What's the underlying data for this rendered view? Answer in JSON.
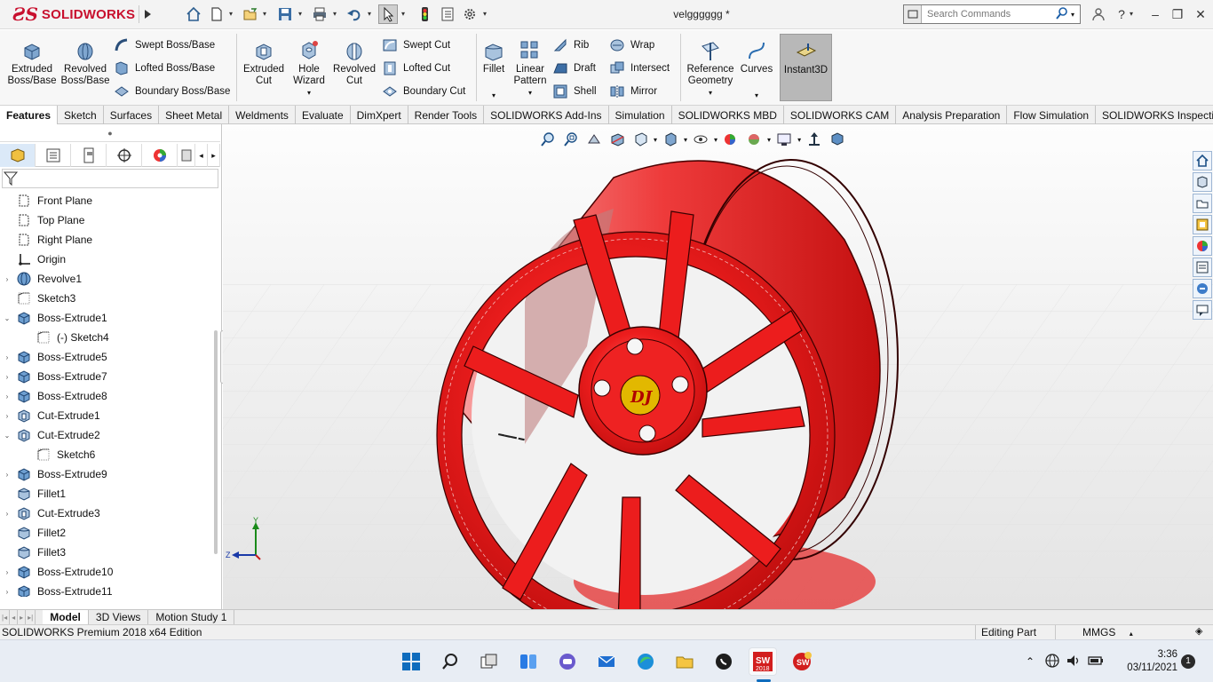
{
  "app": {
    "name": "SOLIDWORKS",
    "document_title": "velgggggg *"
  },
  "search": {
    "placeholder": "Search Commands"
  },
  "ribbon": {
    "extruded_boss": "Extruded\nBoss/Base",
    "revolved_boss": "Revolved\nBoss/Base",
    "swept_boss": "Swept Boss/Base",
    "lofted_boss": "Lofted Boss/Base",
    "boundary_boss": "Boundary Boss/Base",
    "extruded_cut": "Extruded\nCut",
    "hole_wizard": "Hole\nWizard",
    "revolved_cut": "Revolved\nCut",
    "swept_cut": "Swept Cut",
    "lofted_cut": "Lofted Cut",
    "boundary_cut": "Boundary Cut",
    "fillet": "Fillet",
    "linear_pattern": "Linear\nPattern",
    "rib": "Rib",
    "draft": "Draft",
    "shell": "Shell",
    "wrap": "Wrap",
    "intersect": "Intersect",
    "mirror": "Mirror",
    "reference_geometry": "Reference\nGeometry",
    "curves": "Curves",
    "instant3d": "Instant3D"
  },
  "command_tabs": [
    "Features",
    "Sketch",
    "Surfaces",
    "Sheet Metal",
    "Weldments",
    "Evaluate",
    "DimXpert",
    "Render Tools",
    "SOLIDWORKS Add-Ins",
    "Simulation",
    "SOLIDWORKS MBD",
    "SOLIDWORKS CAM",
    "Analysis Preparation",
    "Flow Simulation",
    "SOLIDWORKS Inspection"
  ],
  "tree": {
    "items": [
      {
        "label": "Front Plane",
        "icon": "plane-icon",
        "expand": ""
      },
      {
        "label": "Top Plane",
        "icon": "plane-icon",
        "expand": ""
      },
      {
        "label": "Right Plane",
        "icon": "plane-icon",
        "expand": ""
      },
      {
        "label": "Origin",
        "icon": "origin-icon",
        "expand": ""
      },
      {
        "label": "Revolve1",
        "icon": "revolve-feature-icon",
        "expand": "›"
      },
      {
        "label": "Sketch3",
        "icon": "sketch-icon",
        "expand": ""
      },
      {
        "label": "Boss-Extrude1",
        "icon": "extrude-feature-icon",
        "expand": "⌄"
      },
      {
        "label": "(-) Sketch4",
        "icon": "sketch-icon",
        "expand": ""
      },
      {
        "label": "Boss-Extrude5",
        "icon": "extrude-feature-icon",
        "expand": "›"
      },
      {
        "label": "Boss-Extrude7",
        "icon": "extrude-feature-icon",
        "expand": "›"
      },
      {
        "label": "Boss-Extrude8",
        "icon": "extrude-feature-icon",
        "expand": "›"
      },
      {
        "label": "Cut-Extrude1",
        "icon": "cut-feature-icon",
        "expand": "›"
      },
      {
        "label": "Cut-Extrude2",
        "icon": "cut-feature-icon",
        "expand": "⌄"
      },
      {
        "label": "Sketch6",
        "icon": "sketch-icon",
        "expand": ""
      },
      {
        "label": "Boss-Extrude9",
        "icon": "extrude-feature-icon",
        "expand": "›"
      },
      {
        "label": "Fillet1",
        "icon": "fillet-feature-icon",
        "expand": ""
      },
      {
        "label": "Cut-Extrude3",
        "icon": "cut-feature-icon",
        "expand": "›"
      },
      {
        "label": "Fillet2",
        "icon": "fillet-feature-icon",
        "expand": ""
      },
      {
        "label": "Fillet3",
        "icon": "fillet-feature-icon",
        "expand": ""
      },
      {
        "label": "Boss-Extrude10",
        "icon": "extrude-feature-icon",
        "expand": "›"
      },
      {
        "label": "Boss-Extrude11",
        "icon": "extrude-feature-icon",
        "expand": "›"
      }
    ]
  },
  "bottom_tabs": [
    "Model",
    "3D Views",
    "Motion Study 1"
  ],
  "status": {
    "edition": "SOLIDWORKS Premium 2018 x64 Edition",
    "mode": "Editing Part",
    "units": "MMGS"
  },
  "model": {
    "emblem": "DJ",
    "color": "#e8141c"
  },
  "triad": {
    "x": "X",
    "y": "Y",
    "z": "Z"
  },
  "taskbar": {
    "time": "3:36",
    "date": "03/11/2021",
    "notification_count": "1",
    "sw_badge": "2018"
  }
}
